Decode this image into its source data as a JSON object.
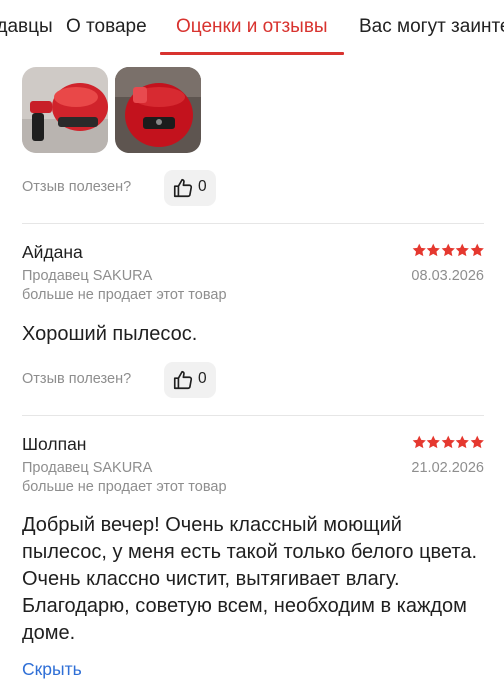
{
  "tabs": [
    {
      "label": "Продавцы"
    },
    {
      "label": "О товаре"
    },
    {
      "label": "Оценки и отзывы"
    },
    {
      "label": "Вас могут заинтересовать"
    }
  ],
  "accent_color": "#d8332f",
  "link_color": "#2f6fd6",
  "star_color": "#e5382f",
  "icons": [
    "like-thumb-icon",
    "star-icon"
  ],
  "prev_review": {
    "photos_count": 2,
    "helpful_label": "Отзыв полезен?",
    "like_count": "0"
  },
  "reviews": [
    {
      "author": "Айдана",
      "rating": 5,
      "date": "08.03.2026",
      "seller": "Продавец SAKURA",
      "seller_note": "больше не продает этот товар",
      "text": "Хороший пылесос.",
      "helpful_label": "Отзыв полезен?",
      "like_count": "0"
    },
    {
      "author": "Шолпан",
      "rating": 5,
      "date": "21.02.2026",
      "seller": "Продавец SAKURA",
      "seller_note": "больше не продает этот товар",
      "text": "Добрый вечер! Очень классный моющий пылесос, у меня есть такой только белого цвета. Очень классно чистит, вытягивает влагу. Благодарю, советую всем, необходим в каждом доме."
    }
  ],
  "hide_link": "Скрыть"
}
